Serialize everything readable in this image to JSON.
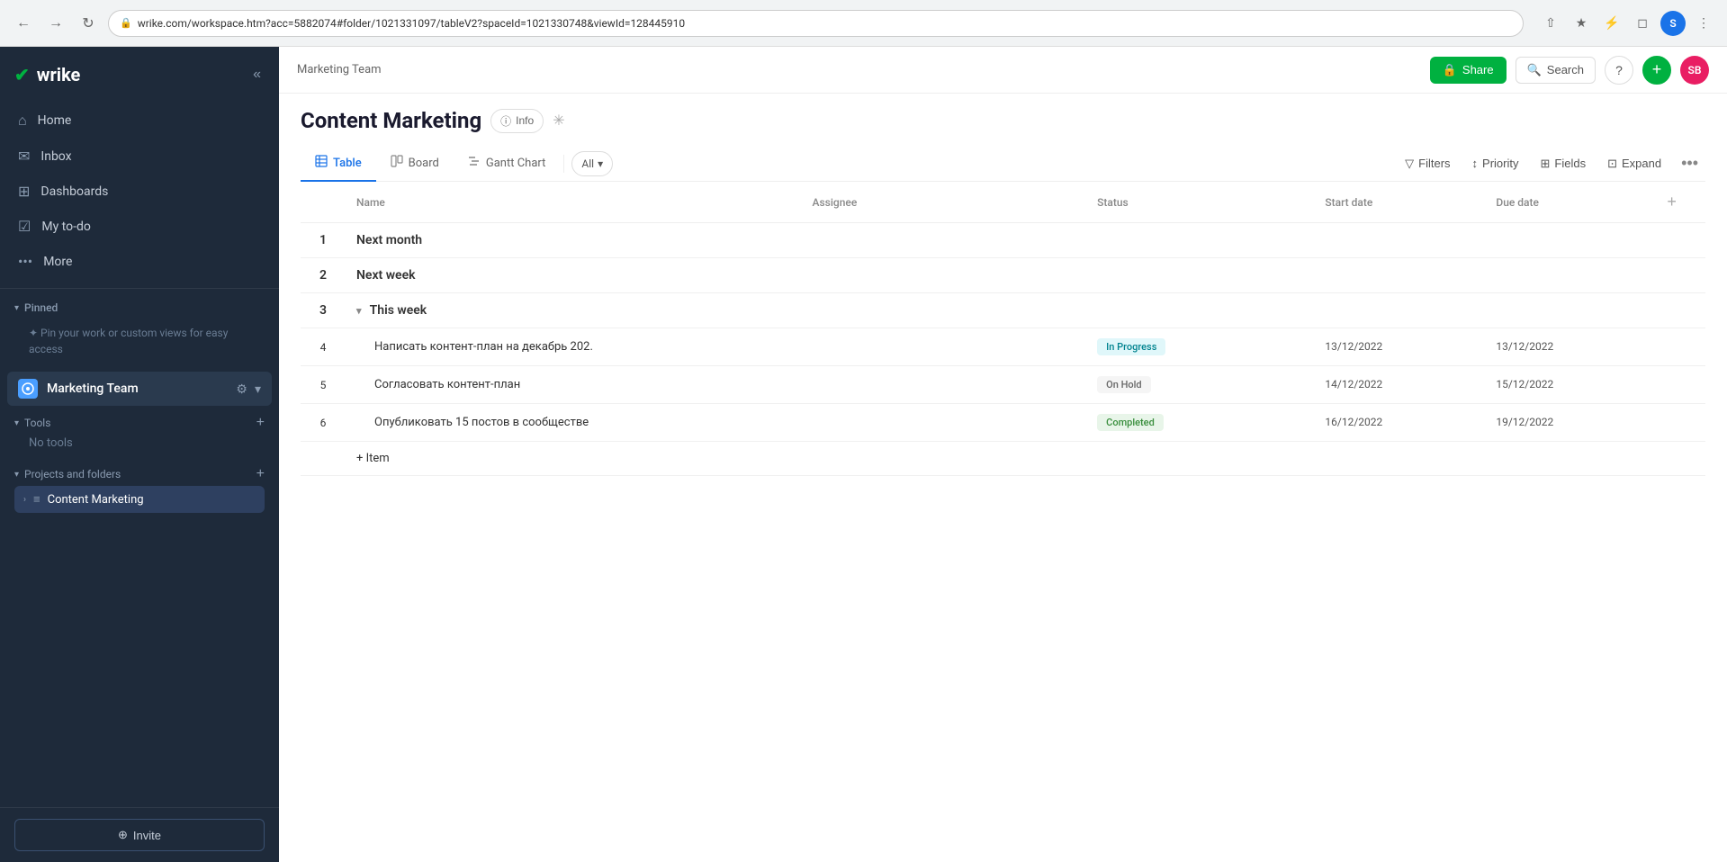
{
  "browser": {
    "url": "wrike.com/workspace.htm?acc=5882074#folder/1021331097/tableV2?spaceId=1021330748&viewId=128445910",
    "back_icon": "←",
    "forward_icon": "→",
    "reload_icon": "↺",
    "profile_initial": "S"
  },
  "sidebar": {
    "logo": "wrike",
    "logo_check": "✓",
    "collapse_icon": "«",
    "nav_items": [
      {
        "icon": "⌂",
        "label": "Home"
      },
      {
        "icon": "✉",
        "label": "Inbox"
      },
      {
        "icon": "⊞",
        "label": "Dashboards"
      },
      {
        "icon": "☑",
        "label": "My to-do"
      },
      {
        "icon": "···",
        "label": "More"
      }
    ],
    "pinned_section": {
      "label": "Pinned",
      "chevron": "▾",
      "hint_icon": "✦",
      "hint_text": "Pin your work or custom views for easy access"
    },
    "workspace": {
      "icon": "◈",
      "name": "Marketing Team",
      "gear_icon": "⚙",
      "chevron_icon": "▾"
    },
    "tools_section": {
      "label": "Tools",
      "chevron": "▾",
      "add_icon": "+",
      "empty_text": "No tools"
    },
    "projects_section": {
      "label": "Projects and folders",
      "chevron": "▾",
      "add_icon": "+"
    },
    "project_item": {
      "chevron": "›",
      "icon": "≡",
      "name": "Content Marketing"
    },
    "footer": {
      "invite_icon": "⊕",
      "invite_label": "Invite"
    }
  },
  "topbar": {
    "breadcrumb": "Marketing Team",
    "share_icon": "🔒",
    "share_label": "Share",
    "search_icon": "🔍",
    "search_label": "Search",
    "help_icon": "?",
    "add_icon": "+",
    "user_initials": "SB"
  },
  "content": {
    "page_title": "Content Marketing",
    "info_icon": "ⓘ",
    "info_label": "Info",
    "pin_icon": "⊹",
    "tabs": [
      {
        "icon": "⊞",
        "label": "Table",
        "active": true
      },
      {
        "icon": "⊟",
        "label": "Board",
        "active": false
      },
      {
        "icon": "☰",
        "label": "Gantt Chart",
        "active": false
      }
    ],
    "all_dropdown": {
      "label": "All",
      "chevron": "▾"
    },
    "toolbar_buttons": [
      {
        "icon": "▽",
        "label": "Filters"
      },
      {
        "icon": "↕",
        "label": "Priority"
      },
      {
        "icon": "⊞",
        "label": "Fields"
      },
      {
        "icon": "⊡",
        "label": "Expand"
      }
    ],
    "more_icon": "···",
    "table": {
      "columns": [
        {
          "key": "num",
          "label": ""
        },
        {
          "key": "name",
          "label": "Name"
        },
        {
          "key": "assignee",
          "label": "Assignee"
        },
        {
          "key": "status",
          "label": "Status"
        },
        {
          "key": "start_date",
          "label": "Start date"
        },
        {
          "key": "due_date",
          "label": "Due date"
        }
      ],
      "rows": [
        {
          "num": "1",
          "name": "Next month",
          "assignee": "",
          "status": "",
          "start_date": "",
          "due_date": "",
          "type": "group"
        },
        {
          "num": "2",
          "name": "Next week",
          "assignee": "",
          "status": "",
          "start_date": "",
          "due_date": "",
          "type": "group"
        },
        {
          "num": "3",
          "name": "This week",
          "assignee": "",
          "status": "",
          "start_date": "",
          "due_date": "",
          "type": "group",
          "collapsed": false
        },
        {
          "num": "4",
          "name": "Написать контент-план на декабрь 202.",
          "assignee": "",
          "status": "In Progress",
          "status_class": "status-in-progress",
          "start_date": "13/12/2022",
          "due_date": "13/12/2022",
          "type": "task"
        },
        {
          "num": "5",
          "name": "Согласовать контент-план",
          "assignee": "",
          "status": "On Hold",
          "status_class": "status-on-hold",
          "start_date": "14/12/2022",
          "due_date": "15/12/2022",
          "type": "task"
        },
        {
          "num": "6",
          "name": "Опубликовать 15 постов в сообществе",
          "assignee": "",
          "status": "Completed",
          "status_class": "status-completed",
          "start_date": "16/12/2022",
          "due_date": "19/12/2022",
          "type": "task"
        }
      ],
      "add_item_label": "+ Item"
    }
  }
}
